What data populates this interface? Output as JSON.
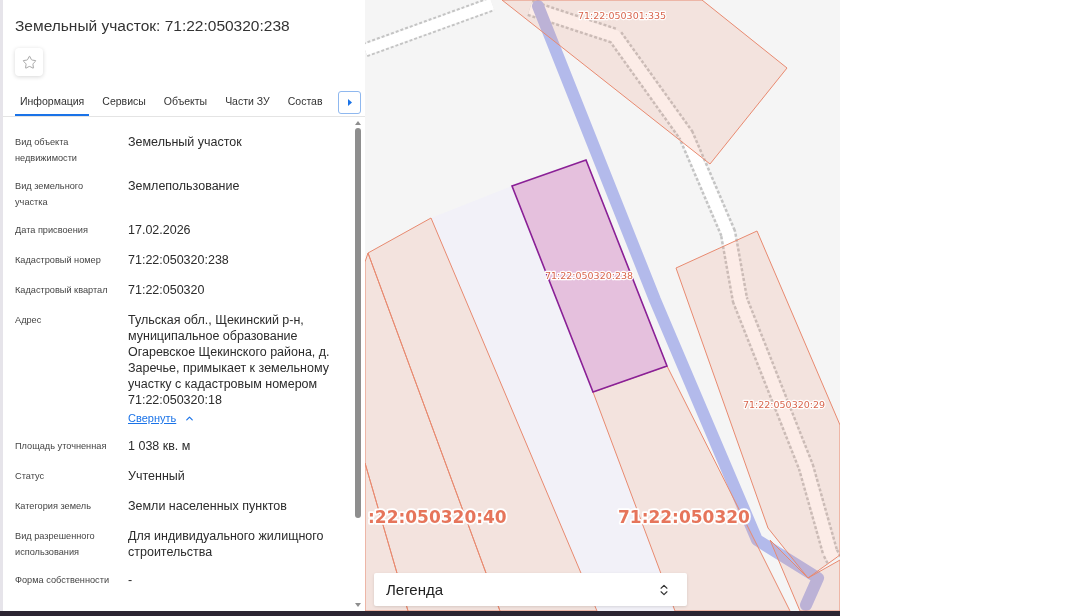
{
  "card": {
    "title": "Земельный участок: 71:22:050320:238",
    "favorite": false,
    "tabs": [
      {
        "label": "Информация",
        "selected": true
      },
      {
        "label": "Сервисы",
        "selected": false
      },
      {
        "label": "Объекты",
        "selected": false
      },
      {
        "label": "Части ЗУ",
        "selected": false
      },
      {
        "label": "Состав",
        "selected": false
      }
    ],
    "fields": [
      {
        "label": "Вид объекта недвижимости",
        "value": "Земельный участок"
      },
      {
        "label": "Вид земельного участка",
        "value": "Землепользование"
      },
      {
        "label": "Дата присвоения",
        "value": "17.02.2026"
      },
      {
        "label": "Кадастровый номер",
        "value": "71:22:050320:238"
      },
      {
        "label": "Кадастровый квартал",
        "value": "71:22:050320"
      },
      {
        "label": "Адрес",
        "value": "Тульская обл., Щекинский р-н, муниципальное образование Огаревское Щекинского района, д. Заречье, примыкает к земельному участку с кадастровым номером 71:22:050320:18",
        "toggle": "Свернуть"
      },
      {
        "label": "Площадь уточненная",
        "value": "1 038 кв. м"
      },
      {
        "label": "Статус",
        "value": "Учтенный"
      },
      {
        "label": "Категория земель",
        "value": "Земли населенных пунктов"
      },
      {
        "label": "Вид разрешенного использования",
        "value": "Для индивидуального жилищного строительства"
      },
      {
        "label": "Форма собственности",
        "value": "-"
      }
    ]
  },
  "map": {
    "parcels": [
      {
        "label": "71:22:050301:335",
        "selected": false
      },
      {
        "label": "71:22:050320:238",
        "selected": true
      },
      {
        "label": "71:22:050320:29",
        "selected": false
      }
    ],
    "labels": [
      {
        "text": ":22:050320:40"
      },
      {
        "text": "71:22:050320"
      }
    ],
    "legend": {
      "label": "Легенда"
    }
  }
}
